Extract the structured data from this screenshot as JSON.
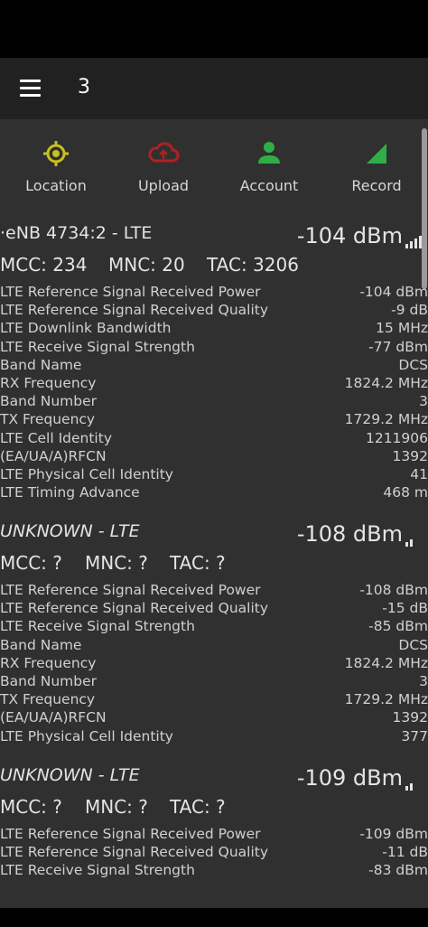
{
  "app_bar": {
    "title": "3",
    "menu_icon": "hamburger-menu-icon"
  },
  "actions": [
    {
      "label": "Location",
      "icon": "crosshair-icon",
      "color": "#c9c020"
    },
    {
      "label": "Upload",
      "icon": "cloud-upload-icon",
      "color": "#b02020"
    },
    {
      "label": "Account",
      "icon": "person-icon",
      "color": "#2fae48"
    },
    {
      "label": "Record",
      "icon": "signal-wedge-icon",
      "color": "#2fae48"
    }
  ],
  "cells": [
    {
      "title": "·eNB 4734:2 - LTE",
      "dbm": "-104 dBm",
      "mcc": "MCC: 234",
      "mnc": "MNC: 20",
      "tac": "TAC: 3206",
      "rows": [
        {
          "label": "LTE Reference Signal Received Power",
          "value": "-104 dBm"
        },
        {
          "label": "LTE Reference Signal Received Quality",
          "value": "-9 dB"
        },
        {
          "label": "LTE Downlink Bandwidth",
          "value": "15 MHz"
        },
        {
          "label": "LTE Receive Signal Strength",
          "value": "-77 dBm"
        },
        {
          "label": "Band Name",
          "value": "DCS"
        },
        {
          "label": "RX Frequency",
          "value": "1824.2 MHz"
        },
        {
          "label": "Band Number",
          "value": "3"
        },
        {
          "label": "TX Frequency",
          "value": "1729.2 MHz"
        },
        {
          "label": "LTE Cell Identity",
          "value": "1211906"
        },
        {
          "label": "(EA/UA/A)RFCN",
          "value": "1392"
        },
        {
          "label": "LTE Physical Cell Identity",
          "value": "41"
        },
        {
          "label": "LTE Timing Advance",
          "value": "468 m"
        }
      ]
    },
    {
      "title": "UNKNOWN - LTE",
      "dbm": "-108 dBm",
      "mcc": "MCC: ?",
      "mnc": "MNC: ?",
      "tac": "TAC: ?",
      "rows": [
        {
          "label": "LTE Reference Signal Received Power",
          "value": "-108 dBm"
        },
        {
          "label": "LTE Reference Signal Received Quality",
          "value": "-15 dB"
        },
        {
          "label": "LTE Receive Signal Strength",
          "value": "-85 dBm"
        },
        {
          "label": "Band Name",
          "value": "DCS"
        },
        {
          "label": "RX Frequency",
          "value": "1824.2 MHz"
        },
        {
          "label": "Band Number",
          "value": "3"
        },
        {
          "label": "TX Frequency",
          "value": "1729.2 MHz"
        },
        {
          "label": "(EA/UA/A)RFCN",
          "value": "1392"
        },
        {
          "label": "LTE Physical Cell Identity",
          "value": "377"
        }
      ]
    },
    {
      "title": "UNKNOWN - LTE",
      "dbm": "-109 dBm",
      "mcc": "MCC: ?",
      "mnc": "MNC: ?",
      "tac": "TAC: ?",
      "rows": [
        {
          "label": "LTE Reference Signal Received Power",
          "value": "-109 dBm"
        },
        {
          "label": "LTE Reference Signal Received Quality",
          "value": "-11 dB"
        },
        {
          "label": "LTE Receive Signal Strength",
          "value": "-83 dBm"
        }
      ]
    }
  ]
}
